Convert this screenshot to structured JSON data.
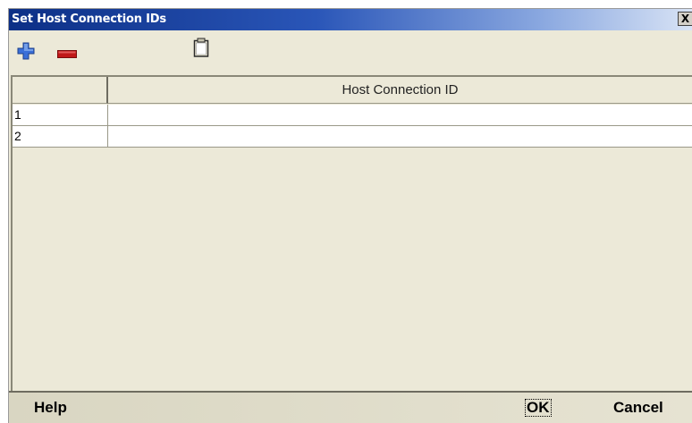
{
  "window": {
    "title": "Set Host Connection IDs",
    "close_label": "X"
  },
  "toolbar": {
    "add_icon": "plus-icon",
    "remove_icon": "minus-icon",
    "paste_icon": "clipboard-icon",
    "colors": {
      "add": "#3a6fd8",
      "remove": "#c01818"
    }
  },
  "table": {
    "columns": [
      "",
      "Host Connection ID"
    ],
    "rows": [
      {
        "index": "1",
        "value": ""
      },
      {
        "index": "2",
        "value": ""
      }
    ]
  },
  "footer": {
    "help_label": "Help",
    "ok_label": "OK",
    "cancel_label": "Cancel"
  }
}
